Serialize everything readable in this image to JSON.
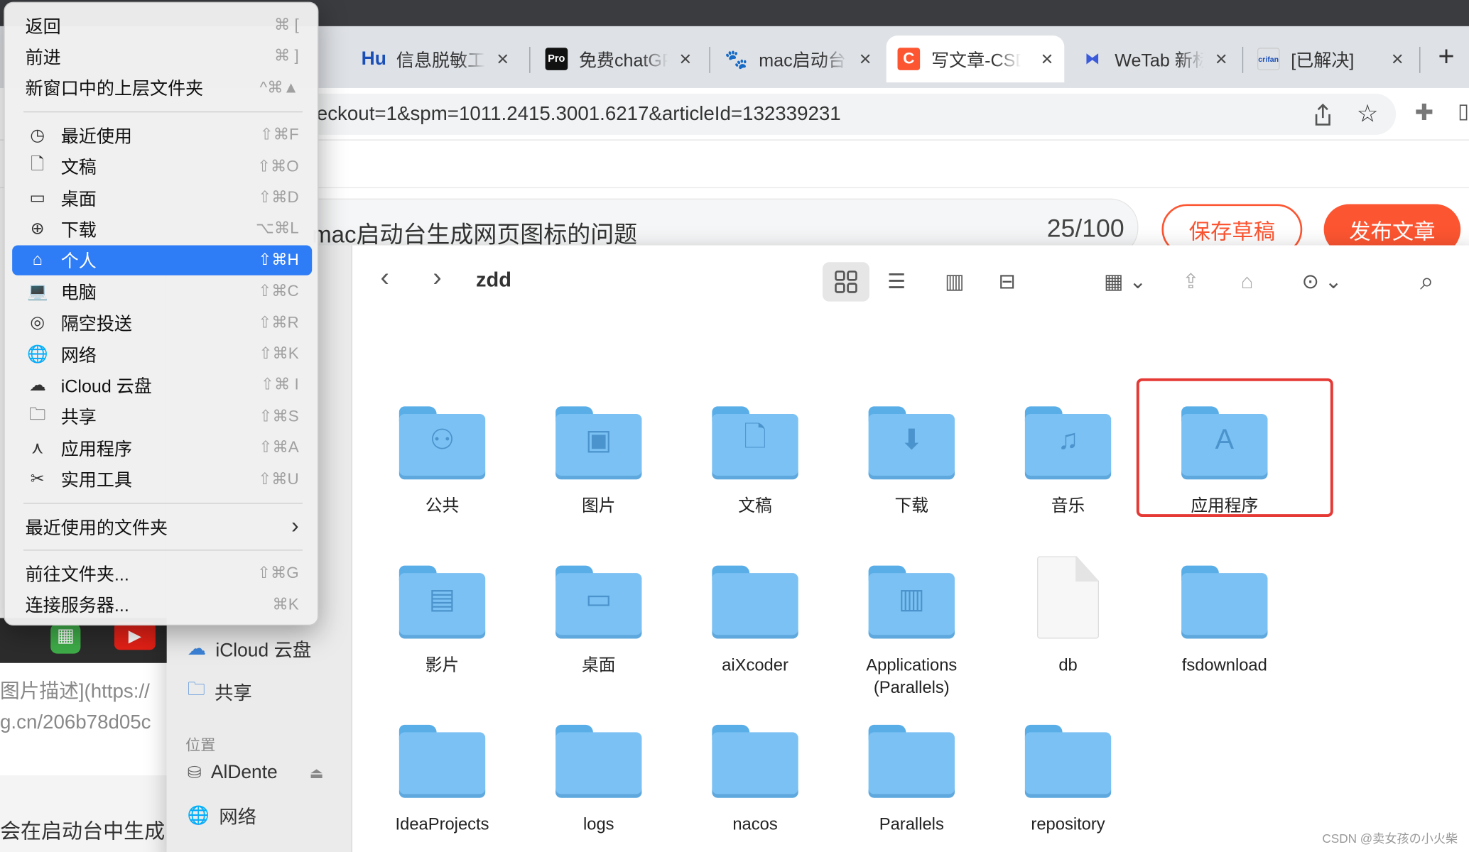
{
  "browser": {
    "tabs": [
      {
        "favicon": "Hu",
        "title": "信息脱敏工",
        "close": "×"
      },
      {
        "favicon": "Pro",
        "title": "免费chatGPT",
        "close": "×"
      },
      {
        "favicon": "baidu-paw-icon",
        "title": "mac启动台",
        "close": "×"
      },
      {
        "favicon": "C",
        "title": "写文章-CSDN",
        "close": "×",
        "active": true
      },
      {
        "favicon": "wetab-icon",
        "title": "WeTab 新标",
        "close": "×"
      },
      {
        "favicon": "crifan",
        "title": "[已解决]",
        "close": "×"
      }
    ],
    "new_tab": "+",
    "url": "eckout=1&spm=1011.2415.3001.6217&articleId=132339231"
  },
  "editor": {
    "title": "mac启动台生成网页图标的问题",
    "counter": "25/100",
    "save_label": "保存草稿",
    "publish_label": "发布文章",
    "bg_lines": [
      "图片描述](https://",
      "g.cn/206b78d05c",
      "会在启动台中生成"
    ]
  },
  "finder": {
    "current_folder": "zdd",
    "sidebar": {
      "top_items": [
        {
          "icon": "cloud-icon",
          "label": "iCloud 云盘"
        },
        {
          "icon": "shared-folder-icon",
          "label": "共享"
        }
      ],
      "location_header": "位置",
      "locations": [
        {
          "icon": "drive-icon",
          "label": "AlDente",
          "eject": "⏏"
        },
        {
          "icon": "globe-icon",
          "label": "网络"
        }
      ]
    },
    "items": [
      {
        "name": "公共",
        "kind": "folder",
        "glyph": "⚇"
      },
      {
        "name": "图片",
        "kind": "folder",
        "glyph": "▣"
      },
      {
        "name": "文稿",
        "kind": "folder",
        "glyph": "🗋"
      },
      {
        "name": "下载",
        "kind": "folder",
        "glyph": "⬇"
      },
      {
        "name": "音乐",
        "kind": "folder",
        "glyph": "♫"
      },
      {
        "name": "应用程序",
        "kind": "folder",
        "glyph": "A",
        "highlighted": true
      },
      {
        "name": "影片",
        "kind": "folder",
        "glyph": "▤"
      },
      {
        "name": "桌面",
        "kind": "folder",
        "glyph": "▭"
      },
      {
        "name": "aiXcoder",
        "kind": "folder",
        "glyph": ""
      },
      {
        "name": "Applications\n(Parallels)",
        "kind": "folder",
        "glyph": "▥"
      },
      {
        "name": "db",
        "kind": "file",
        "glyph": ""
      },
      {
        "name": "fsdownload",
        "kind": "folder",
        "glyph": ""
      },
      {
        "name": "IdeaProjects",
        "kind": "folder",
        "glyph": ""
      },
      {
        "name": "logs",
        "kind": "folder",
        "glyph": ""
      },
      {
        "name": "nacos",
        "kind": "folder",
        "glyph": ""
      },
      {
        "name": "Parallels",
        "kind": "folder",
        "glyph": ""
      },
      {
        "name": "repository",
        "kind": "folder",
        "glyph": ""
      }
    ]
  },
  "go_menu": {
    "items": [
      {
        "type": "item",
        "icon": "",
        "label": "返回",
        "shortcut": "⌘ ["
      },
      {
        "type": "item",
        "icon": "",
        "label": "前进",
        "shortcut": "⌘ ]"
      },
      {
        "type": "item",
        "icon": "",
        "label": "新窗口中的上层文件夹",
        "shortcut": "^⌘▲"
      },
      {
        "type": "sep"
      },
      {
        "type": "item",
        "icon": "clock-icon",
        "label": "最近使用",
        "shortcut": "⇧⌘F"
      },
      {
        "type": "item",
        "icon": "document-icon",
        "label": "文稿",
        "shortcut": "⇧⌘O"
      },
      {
        "type": "item",
        "icon": "desktop-icon",
        "label": "桌面",
        "shortcut": "⇧⌘D"
      },
      {
        "type": "item",
        "icon": "download-icon",
        "label": "下载",
        "shortcut": "⌥⌘L"
      },
      {
        "type": "item",
        "icon": "home-icon",
        "label": "个人",
        "shortcut": "⇧⌘H",
        "selected": true
      },
      {
        "type": "item",
        "icon": "laptop-icon",
        "label": "电脑",
        "shortcut": "⇧⌘C"
      },
      {
        "type": "item",
        "icon": "airdrop-icon",
        "label": "隔空投送",
        "shortcut": "⇧⌘R"
      },
      {
        "type": "item",
        "icon": "globe-icon",
        "label": "网络",
        "shortcut": "⇧⌘K"
      },
      {
        "type": "item",
        "icon": "cloud-icon",
        "label": "iCloud 云盘",
        "shortcut": "⇧⌘ I"
      },
      {
        "type": "item",
        "icon": "shared-folder-icon",
        "label": "共享",
        "shortcut": "⇧⌘S"
      },
      {
        "type": "item",
        "icon": "apps-icon",
        "label": "应用程序",
        "shortcut": "⇧⌘A"
      },
      {
        "type": "item",
        "icon": "tools-icon",
        "label": "实用工具",
        "shortcut": "⇧⌘U"
      },
      {
        "type": "sep"
      },
      {
        "type": "item",
        "icon": "",
        "label": "最近使用的文件夹",
        "shortcut": "›",
        "submenu": true
      },
      {
        "type": "sep"
      },
      {
        "type": "item",
        "icon": "",
        "label": "前往文件夹...",
        "shortcut": "⇧⌘G"
      },
      {
        "type": "item",
        "icon": "",
        "label": "连接服务器...",
        "shortcut": "⌘K"
      }
    ]
  },
  "watermark": "CSDN @卖女孩の小火柴",
  "colors": {
    "accent": "#2e7cf6",
    "csdn_red": "#fc5531",
    "folder_blue": "#7bc1f3",
    "highlight_red": "#e53935"
  }
}
